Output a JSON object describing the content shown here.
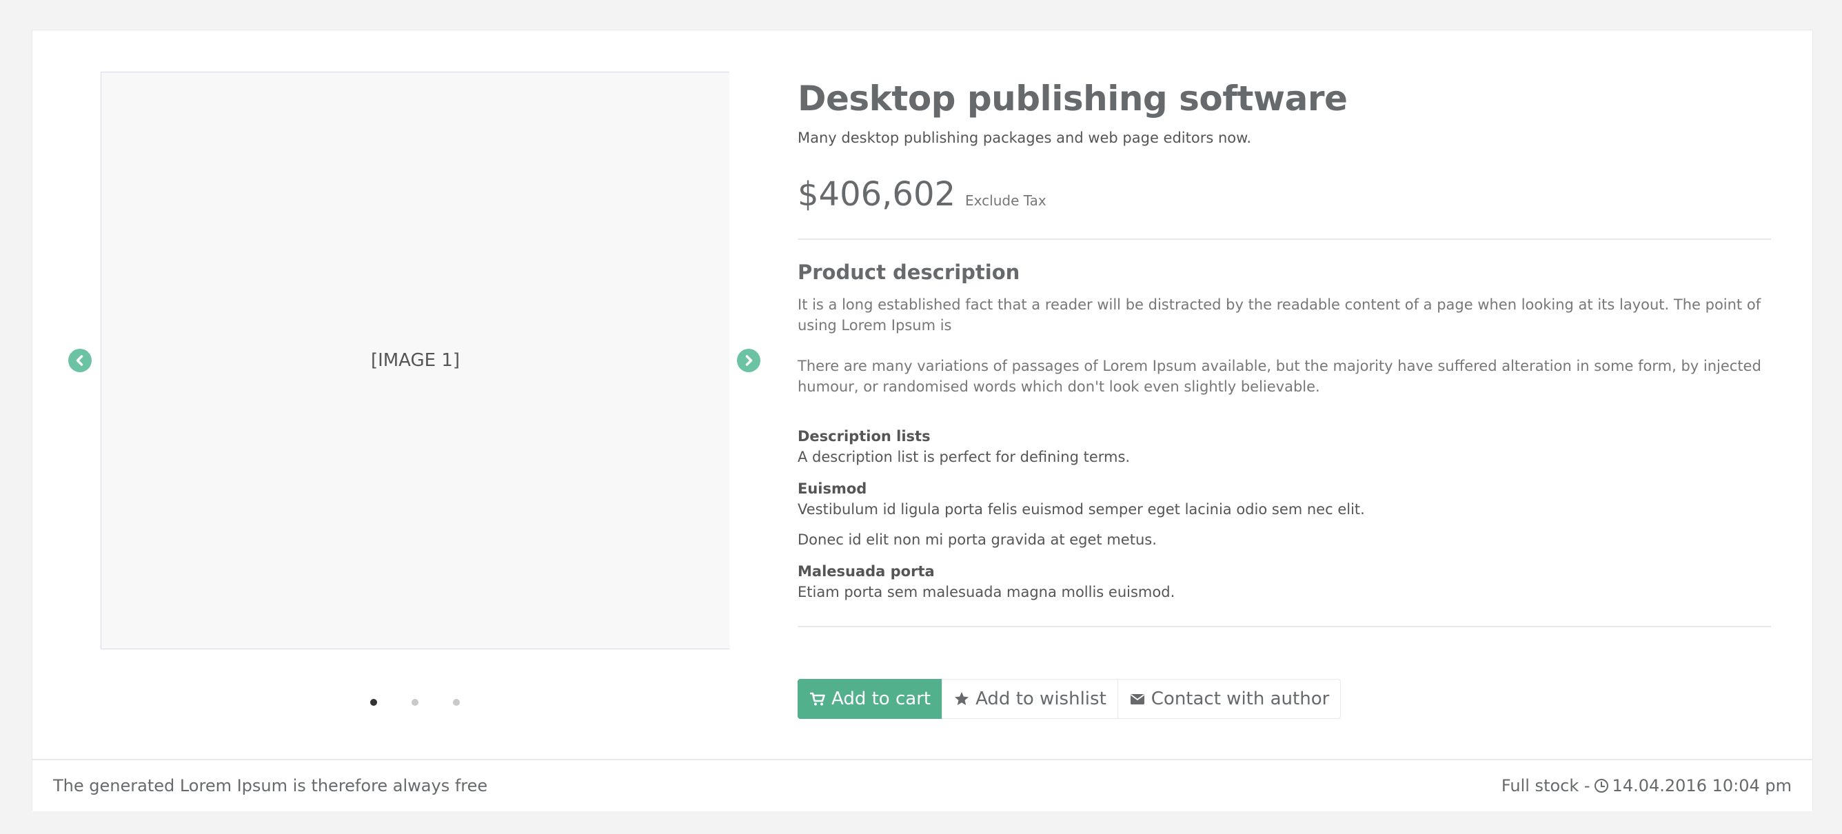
{
  "product": {
    "title": "Desktop publishing software",
    "subtitle": "Many desktop publishing packages and web page editors now.",
    "price": "$406,602",
    "tax_note": "Exclude Tax",
    "description_heading": "Product description",
    "paragraphs": [
      "It is a long established fact that a reader will be distracted by the readable content of a page when looking at its layout. The point of using Lorem Ipsum is",
      "There are many variations of passages of Lorem Ipsum available, but the majority have suffered alteration in some form, by injected humour, or randomised words which don't look even slightly believable."
    ],
    "description_list": [
      {
        "term": "Description lists",
        "defs": [
          "A description list is perfect for defining terms."
        ]
      },
      {
        "term": "Euismod",
        "defs": [
          "Vestibulum id ligula porta felis euismod semper eget lacinia odio sem nec elit.",
          "Donec id elit non mi porta gravida at eget metus."
        ]
      },
      {
        "term": "Malesuada porta",
        "defs": [
          "Etiam porta sem malesuada magna mollis euismod."
        ]
      }
    ]
  },
  "carousel": {
    "slide_label": "[IMAGE 1]",
    "dot_count": 3,
    "active_index": 0
  },
  "actions": {
    "add_to_cart": "Add to cart",
    "add_to_wishlist": "Add to wishlist",
    "contact_author": "Contact with author"
  },
  "footer": {
    "left_text": "The generated Lorem Ipsum is therefore always free",
    "stock_label": "Full stock -",
    "datetime": "14.04.2016 10:04 pm"
  },
  "colors": {
    "accent": "#52b08d",
    "arrow": "#6cc3a4",
    "background": "#f3f3f4"
  },
  "icons": [
    "chevron-left-icon",
    "chevron-right-icon",
    "cart-icon",
    "star-icon",
    "envelope-icon",
    "clock-icon"
  ]
}
